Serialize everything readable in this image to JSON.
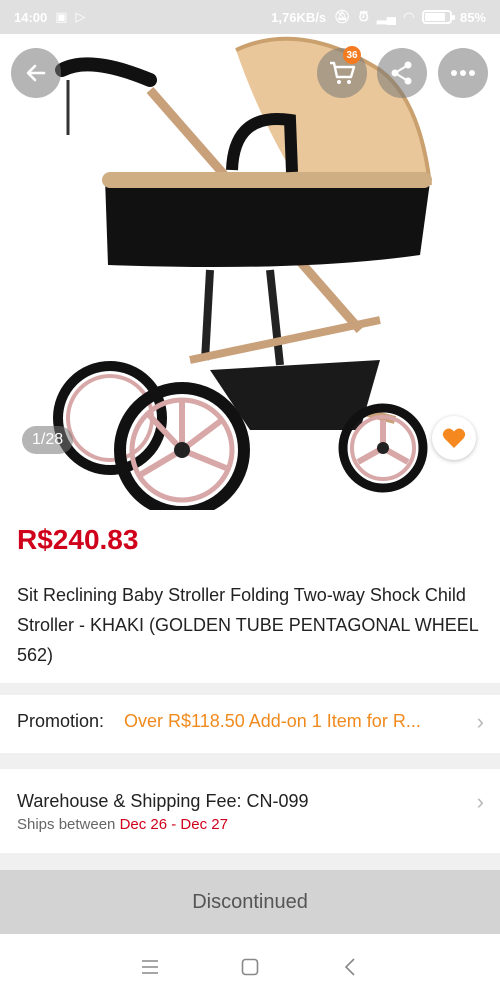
{
  "status_bar": {
    "time": "14:00",
    "speed": "1,76KB/s",
    "battery": "85%",
    "battery_level": 0.85
  },
  "header": {
    "back_icon": "back-arrow-icon",
    "cart_icon": "cart-icon",
    "cart_count": "36",
    "share_icon": "share-icon",
    "more_icon": "more-dots-icon"
  },
  "gallery": {
    "counter": "1/28",
    "favorite_icon": "heart-icon"
  },
  "product": {
    "price": "R$240.83",
    "title": "Sit Reclining Baby Stroller Folding Two-way Shock Child Stroller - KHAKI (GOLDEN TUBE PENTAGONAL WHEEL 562)"
  },
  "promotion": {
    "label": "Promotion:",
    "value": "Over R$118.50 Add-on 1 Item for R..."
  },
  "shipping": {
    "label": "Warehouse & Shipping Fee:  CN-099",
    "ships_prefix": "Ships between ",
    "dates": "Dec 26 - Dec 27"
  },
  "action": {
    "label": "Discontinued"
  },
  "colors": {
    "price": "#d0021b",
    "promo": "#f08a1c",
    "badge": "#f57b20",
    "favorite": "#f5891f"
  }
}
